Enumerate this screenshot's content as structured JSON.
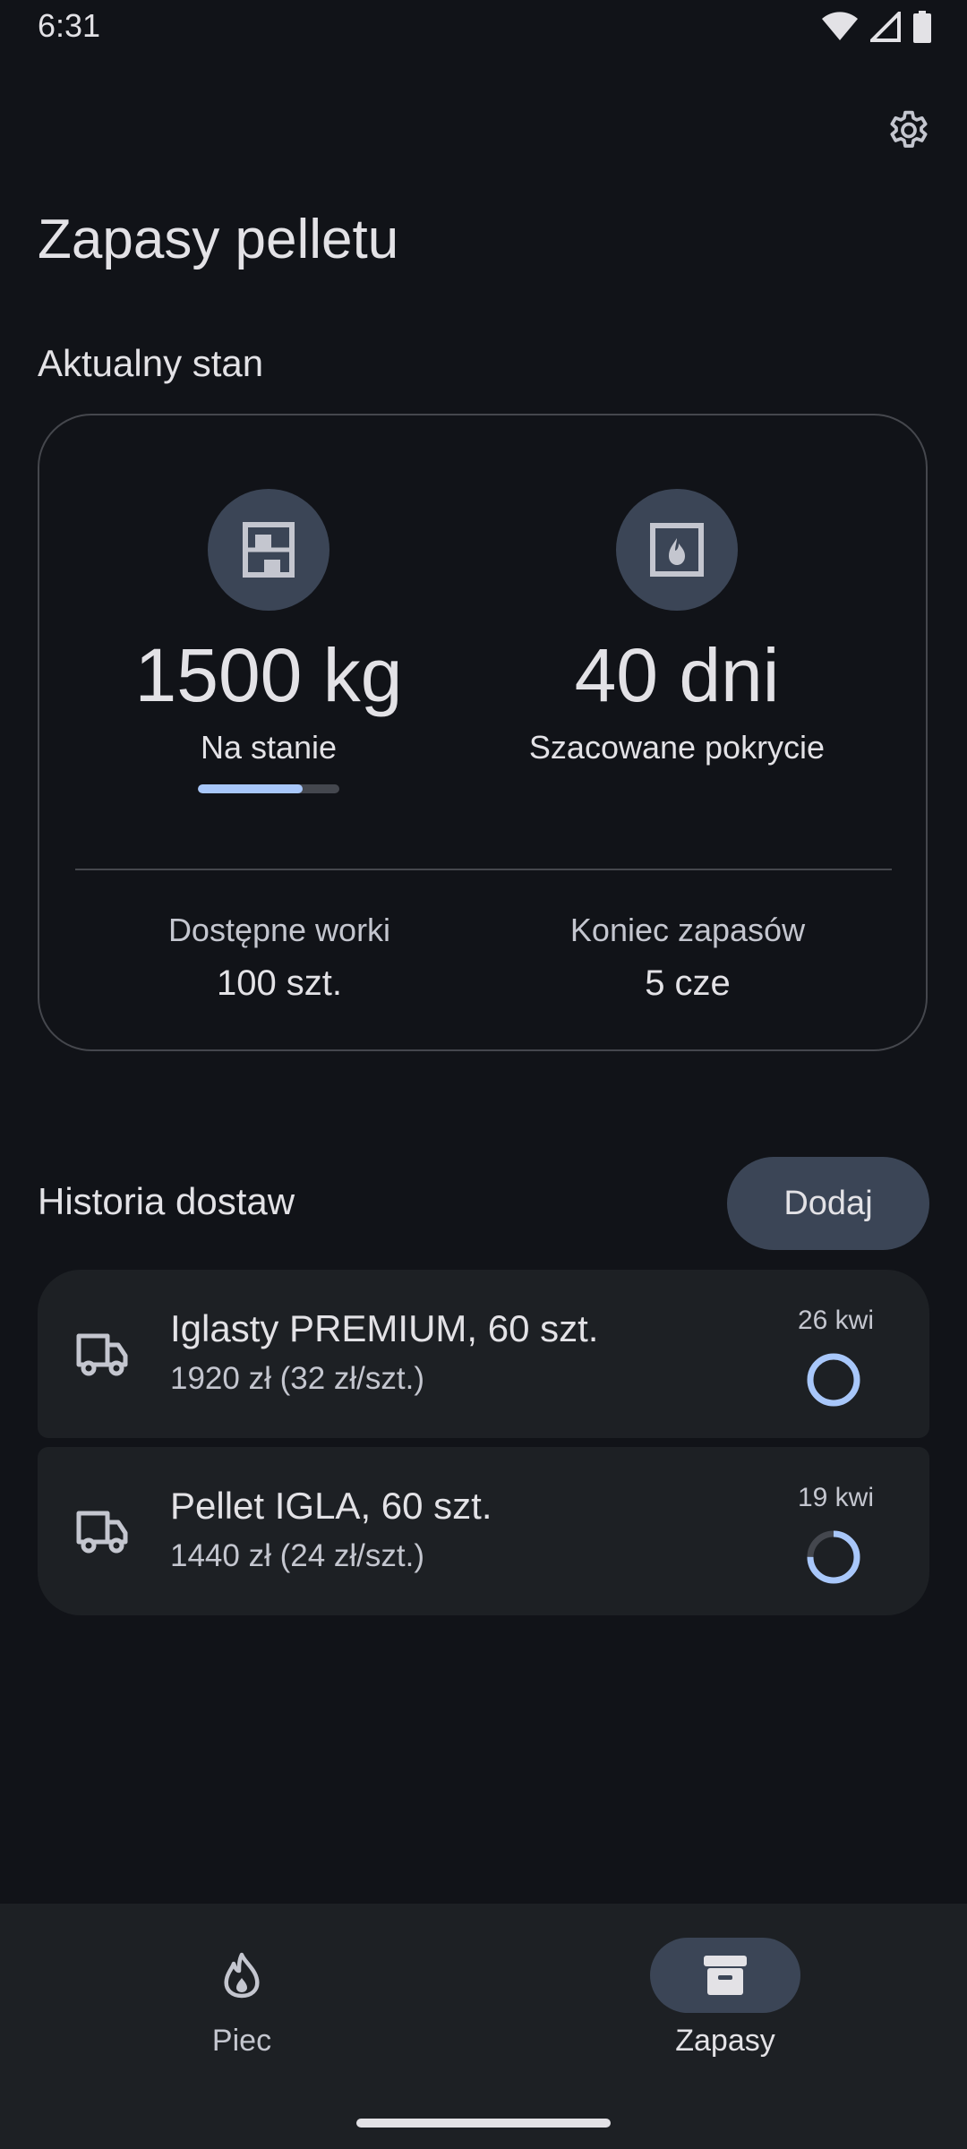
{
  "status_bar": {
    "time": "6:31",
    "icons": [
      "wifi-icon",
      "signal-icon",
      "battery-icon"
    ]
  },
  "header": {
    "title": "Zapasy pelletu",
    "settings_icon": "gear-icon"
  },
  "current_state": {
    "section_label": "Aktualny stan",
    "stock": {
      "icon": "shelves-icon",
      "value": "1500 kg",
      "caption": "Na stanie",
      "progress": 0.74
    },
    "coverage": {
      "icon": "fireplace-icon",
      "value": "40 dni",
      "caption": "Szacowane pokrycie"
    },
    "bags": {
      "label": "Dostępne worki",
      "value": "100 szt."
    },
    "end_date": {
      "label": "Koniec zapasów",
      "value": "5 cze"
    }
  },
  "history": {
    "section_label": "Historia dostaw",
    "add_label": "Dodaj",
    "deliveries": [
      {
        "icon": "truck-icon",
        "name": "Iglasty PREMIUM, 60 szt.",
        "price": "1920 zł (32 zł/szt.)",
        "date": "26 kwi",
        "usage": 1.0
      },
      {
        "icon": "truck-icon",
        "name": "Pellet IGLA, 60 szt.",
        "price": "1440 zł (24 zł/szt.)",
        "date": "19 kwi",
        "usage": 0.75
      }
    ]
  },
  "bottom_nav": {
    "items": [
      {
        "label": "Piec",
        "icon": "flame-icon",
        "active": false
      },
      {
        "label": "Zapasy",
        "icon": "archive-icon",
        "active": true
      }
    ]
  },
  "colors": {
    "background": "#111318",
    "accent": "#a8c7fa",
    "surface": "#1d2024",
    "tonal": "#3b4556"
  }
}
